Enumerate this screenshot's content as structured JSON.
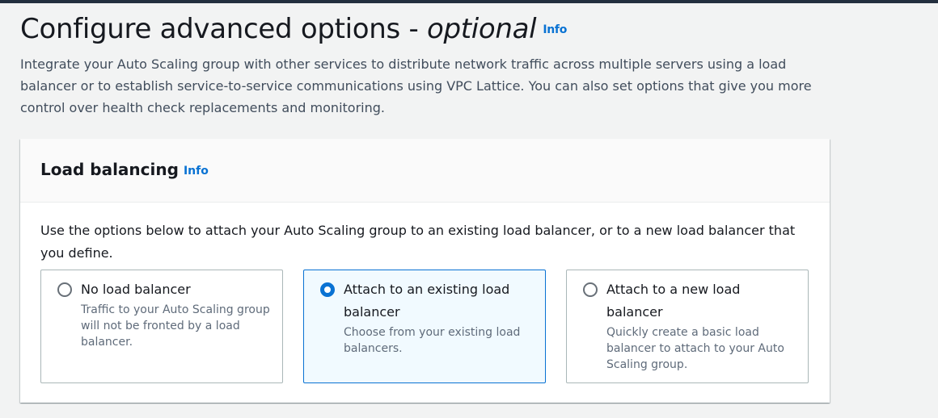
{
  "header": {
    "title_main": "Configure advanced options - ",
    "title_italic": "optional",
    "info_label": "Info",
    "description": "Integrate your Auto Scaling group with other services to distribute network traffic across multiple servers using a load balancer or to establish service-to-service communications using VPC Lattice. You can also set options that give you more control over health check replacements and monitoring."
  },
  "load_balancing": {
    "title": "Load balancing",
    "info_label": "Info",
    "description": "Use the options below to attach your Auto Scaling group to an existing load balancer, or to a new load balancer that you define.",
    "options": [
      {
        "label": "No load balancer",
        "description": "Traffic to your Auto Scaling group will not be fronted by a load balancer.",
        "selected": false
      },
      {
        "label": "Attach to an existing load balancer",
        "description": "Choose from your existing load balancers.",
        "selected": true
      },
      {
        "label": "Attach to a new load balancer",
        "description": "Quickly create a basic load balancer to attach to your Auto Scaling group.",
        "selected": false
      }
    ]
  },
  "colors": {
    "accent": "#0972d3",
    "selected_bg": "#f1faff",
    "top_bar": "#232f3e"
  }
}
